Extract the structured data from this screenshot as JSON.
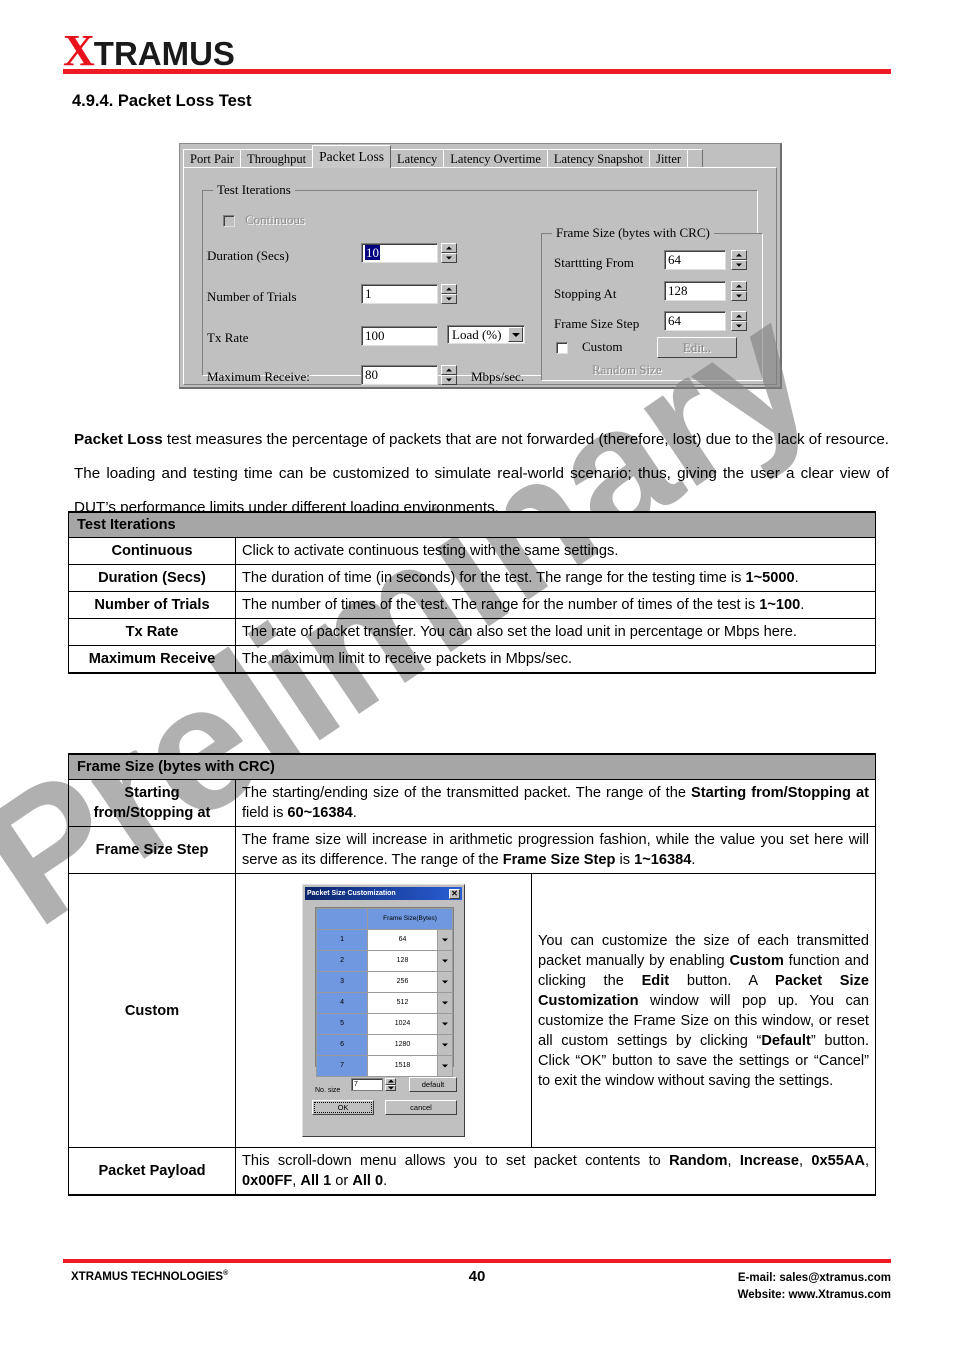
{
  "brand": {
    "logo_x": "X",
    "logo_rest": "TRAMUS"
  },
  "watermark": {
    "text": "Preliminary"
  },
  "section": {
    "title": "4.9.4. Packet Loss Test"
  },
  "dialog": {
    "tabs": [
      {
        "label": "Port Pair",
        "active": false
      },
      {
        "label": "Throughput",
        "active": false
      },
      {
        "label": "Packet Loss",
        "active": true
      },
      {
        "label": "Latency",
        "active": false
      },
      {
        "label": "Latency Overtime",
        "active": false
      },
      {
        "label": "Latency Snapshot",
        "active": false
      },
      {
        "label": "Jitter",
        "active": false
      }
    ],
    "test_iterations": {
      "group_title": "Test Iterations",
      "continuous_label": "Continuous",
      "duration_label": "Duration (Secs)",
      "duration_value": "10",
      "trials_label": "Number of Trials",
      "trials_value": "1",
      "txrate_label": "Tx Rate",
      "txrate_value": "100",
      "txrate_unit": "Load (%)",
      "maxrecv_label": "Maximum Receive:",
      "maxrecv_value": "80",
      "maxrecv_unit": "Mbps/sec."
    },
    "frame_size": {
      "group_title": "Frame Size (bytes with CRC)",
      "start_label": "Starttting From",
      "start_value": "64",
      "stop_label": "Stopping At",
      "stop_value": "128",
      "step_label": "Frame Size Step",
      "step_value": "64",
      "custom_label": "Custom",
      "edit_label": "Edit..",
      "random_label": "Random Size"
    }
  },
  "paragraph": {
    "lead": "Packet Loss",
    "rest": " test measures the percentage of packets that are not forwarded (therefore, lost) due to the lack of resource. The loading and testing time can be customized to simulate real-world scenario; thus, giving the user a clear view of DUT’s performance limits under different loading environments."
  },
  "table_test_iterations": {
    "header": "Test Iterations",
    "rows": [
      {
        "key": "Continuous",
        "desc": "Click to activate continuous testing with the same settings."
      },
      {
        "key": "Duration (Secs)",
        "desc_a": "The duration of time (in seconds) for the test. The range for the testing time is ",
        "desc_b": "1~5000",
        "desc_c": "."
      },
      {
        "key": "Number of Trials",
        "desc_a": "The number of times of the test. The range for the number of times of the test is ",
        "desc_b": "1~100",
        "desc_c": "."
      },
      {
        "key": "Tx Rate",
        "desc": "The rate of packet transfer. You can also set the load unit in percentage or Mbps here."
      },
      {
        "key": "Maximum Receive",
        "desc": "The maximum limit to receive packets in Mbps/sec."
      }
    ]
  },
  "table_frame_size": {
    "header": "Frame Size (bytes with CRC)",
    "row_start": {
      "key_line1": "Starting",
      "key_line2": "from/Stopping at",
      "d1": "The starting/ending size of the transmitted packet. The range of the ",
      "d2": "Starting from/Stopping at",
      "d3": " field is ",
      "d4": "60~16384",
      "d5": "."
    },
    "row_step": {
      "key": "Frame Size Step",
      "d1": "The frame size will increase in arithmetic progression fashion, while the value you set here will serve as its difference. The range of the ",
      "d2": "Frame Size Step",
      "d3": " is ",
      "d4": "1~16384",
      "d5": "."
    },
    "row_custom": {
      "key": "Custom",
      "d1": "You can customize the size of each transmitted packet manually by enabling ",
      "d2": "Custom",
      "d3": " function and clicking the ",
      "d4": "Edit",
      "d5": " button. A ",
      "d6": "Packet Size Customization",
      "d7": " window will pop up. You can customize the Frame Size on this window, or reset all custom settings by clicking “",
      "d8": "Default",
      "d9": "” button. Click “OK” button to save the settings or “Cancel” to exit the window without saving the settings."
    },
    "row_payload": {
      "key": "Packet Payload",
      "d1": "This scroll-down menu allows you to set packet contents to ",
      "d2": "Random",
      "d3": ", ",
      "d4": "Increase",
      "d5": ", ",
      "d6": "0x55AA",
      "d7": ", ",
      "d8": "0x00FF",
      "d9": ", ",
      "d10": "All 1",
      "d11": " or ",
      "d12": "All 0",
      "d13": "."
    }
  },
  "psc_window": {
    "title": "Packet Size Customization",
    "close": "✕",
    "col_header": "Frame Size(Bytes)",
    "rows": [
      {
        "index": "1",
        "size": "64"
      },
      {
        "index": "2",
        "size": "128"
      },
      {
        "index": "3",
        "size": "256"
      },
      {
        "index": "4",
        "size": "512"
      },
      {
        "index": "5",
        "size": "1024"
      },
      {
        "index": "6",
        "size": "1280"
      },
      {
        "index": "7",
        "size": "1518"
      }
    ],
    "no_size_label": "No. size",
    "no_size_value": "7",
    "default_label": "default",
    "ok_label": "OK",
    "cancel_label": "cancel"
  },
  "footer": {
    "company": "XTRAMUS TECHNOLOGIES",
    "company_sup": "®",
    "page": "40",
    "email": "E-mail: sales@xtramus.com",
    "website": "Website:  www.Xtramus.com"
  },
  "colors": {
    "brand_red": "#ee1b24",
    "table_header_gray": "#a6a6a6",
    "win_gray": "#c0c0c0",
    "title_blue": "#0a246a"
  }
}
